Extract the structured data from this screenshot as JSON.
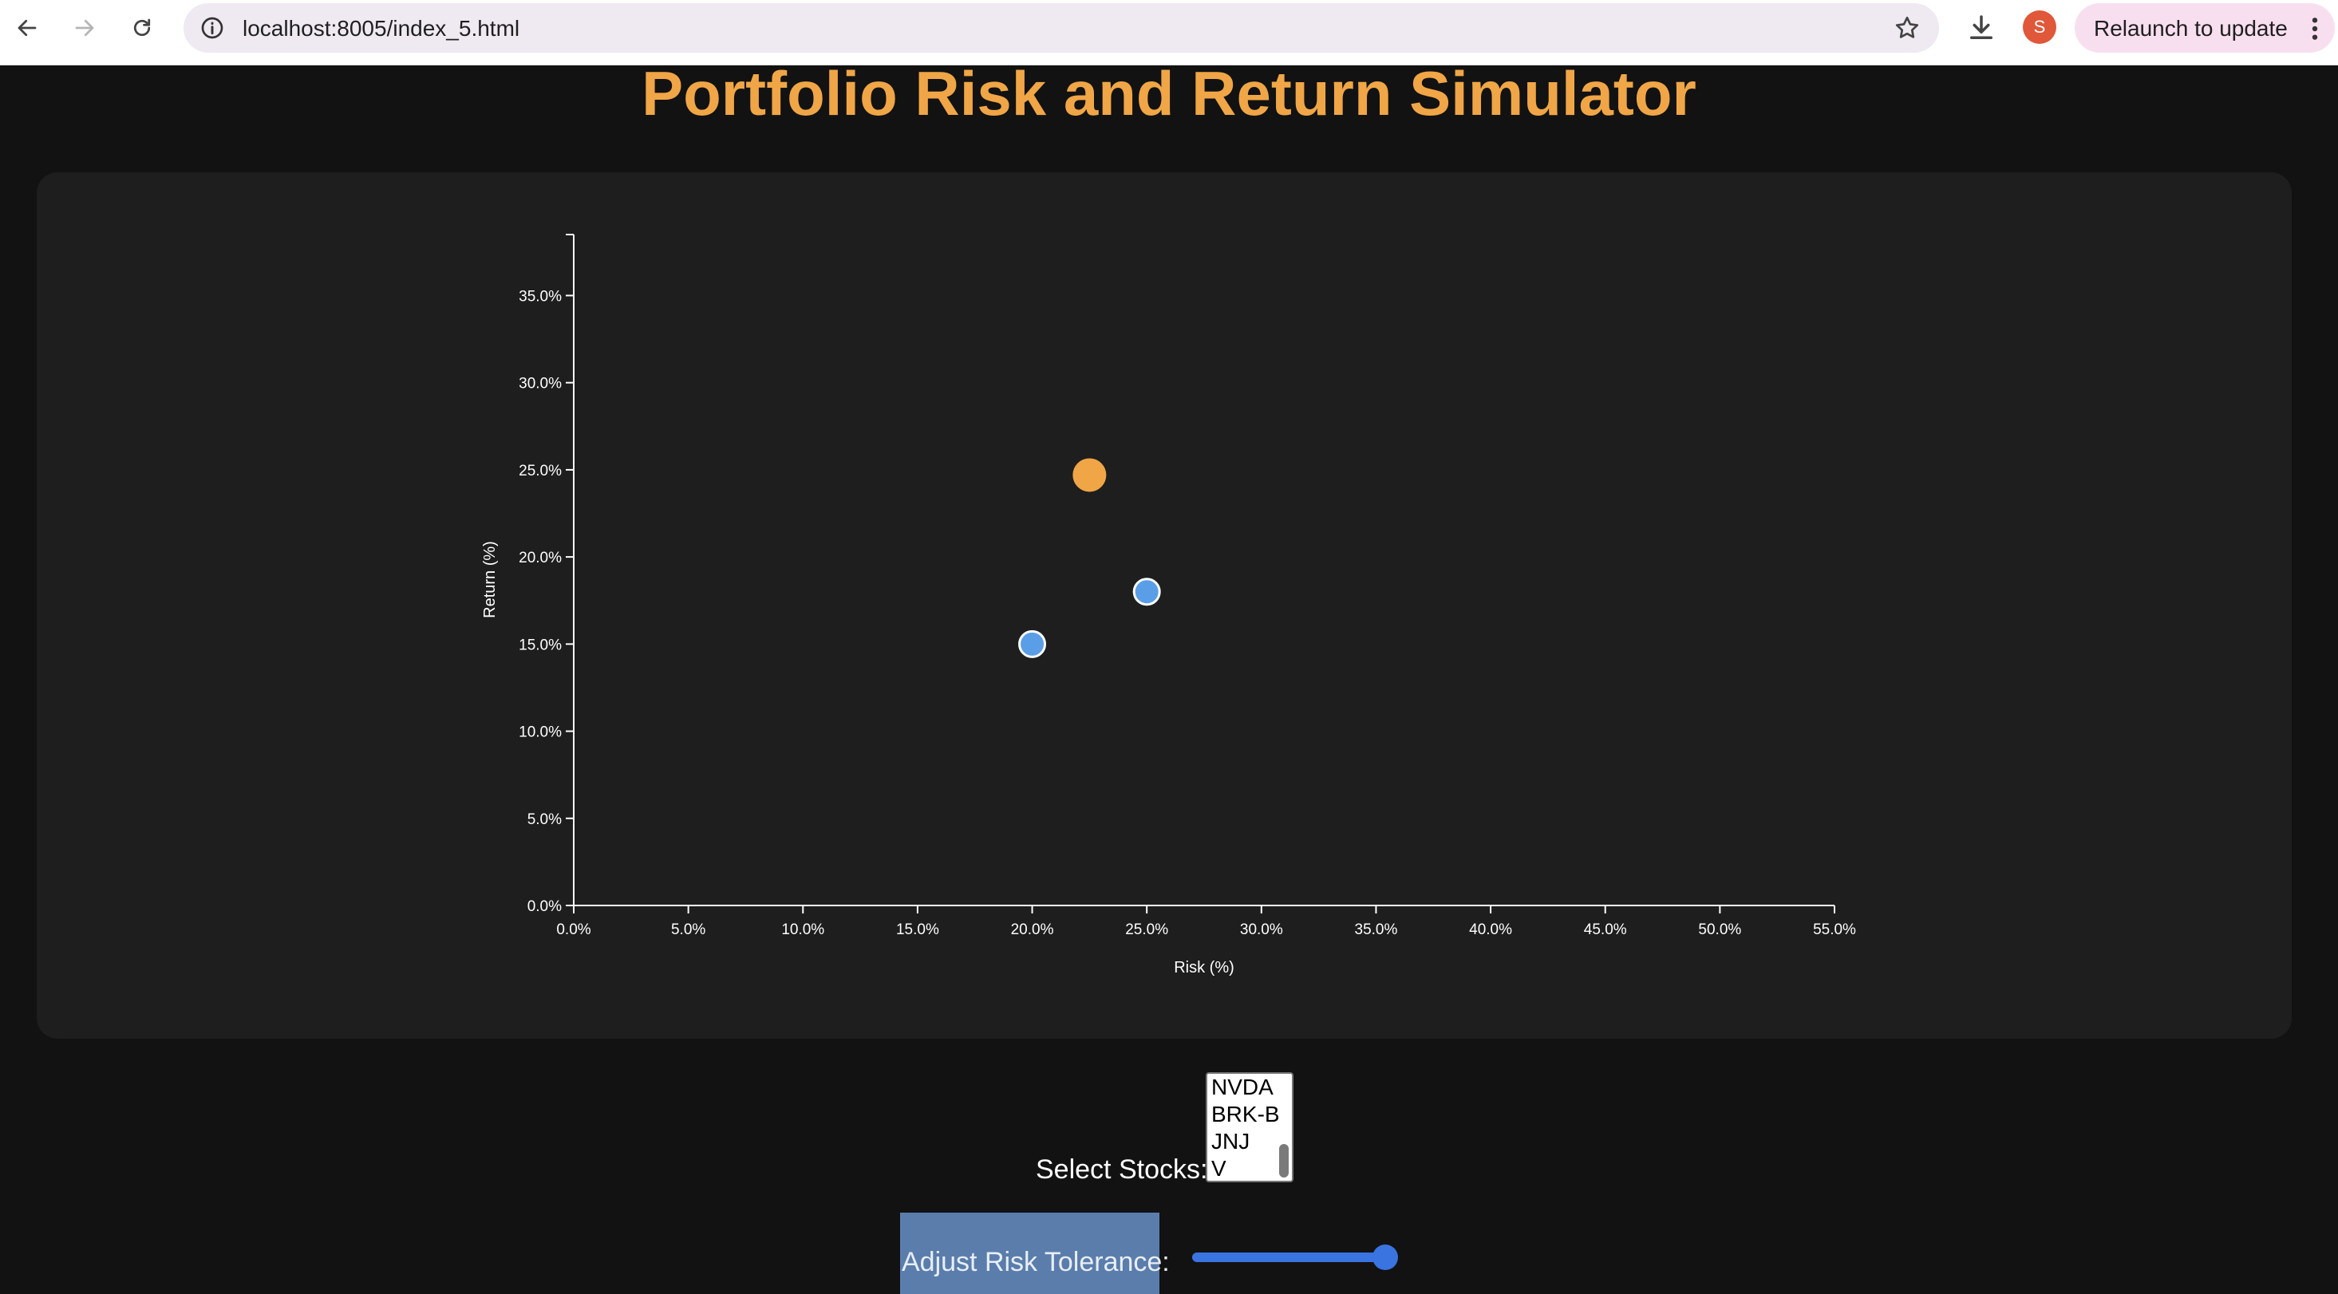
{
  "browser": {
    "url": "localhost:8005/index_5.html",
    "relaunch_label": "Relaunch to update",
    "avatar_initial": "S"
  },
  "page": {
    "title": "Portfolio Risk and Return Simulator",
    "select_label": "Select Stocks:",
    "stocks": [
      "NVDA",
      "BRK-B",
      "JNJ",
      "V"
    ],
    "risk_label": "Adjust Risk Tolerance:",
    "risk_slider_fraction": 1.0
  },
  "colors": {
    "accent": "#f0a646",
    "stock_point": "#5b9ee8",
    "slider": "#3a74e0"
  },
  "chart_data": {
    "type": "scatter",
    "xlabel": "Risk (%)",
    "ylabel": "Return (%)",
    "xlim": [
      0,
      55
    ],
    "ylim": [
      0,
      38.5
    ],
    "xticks": [
      "0.0%",
      "5.0%",
      "10.0%",
      "15.0%",
      "20.0%",
      "25.0%",
      "30.0%",
      "35.0%",
      "40.0%",
      "45.0%",
      "50.0%",
      "55.0%"
    ],
    "xtick_values": [
      0,
      5,
      10,
      15,
      20,
      25,
      30,
      35,
      40,
      45,
      50,
      55
    ],
    "yticks": [
      "0.0%",
      "5.0%",
      "10.0%",
      "15.0%",
      "20.0%",
      "25.0%",
      "30.0%",
      "35.0%"
    ],
    "ytick_values": [
      0,
      5,
      10,
      15,
      20,
      25,
      30,
      35
    ],
    "grid": false,
    "points": [
      {
        "x": 20.0,
        "y": 15.0,
        "kind": "stock",
        "color": "#5b9ee8"
      },
      {
        "x": 25.0,
        "y": 18.0,
        "kind": "stock",
        "color": "#5b9ee8"
      },
      {
        "x": 22.5,
        "y": 24.7,
        "kind": "portfolio",
        "color": "#f0a646"
      }
    ]
  }
}
